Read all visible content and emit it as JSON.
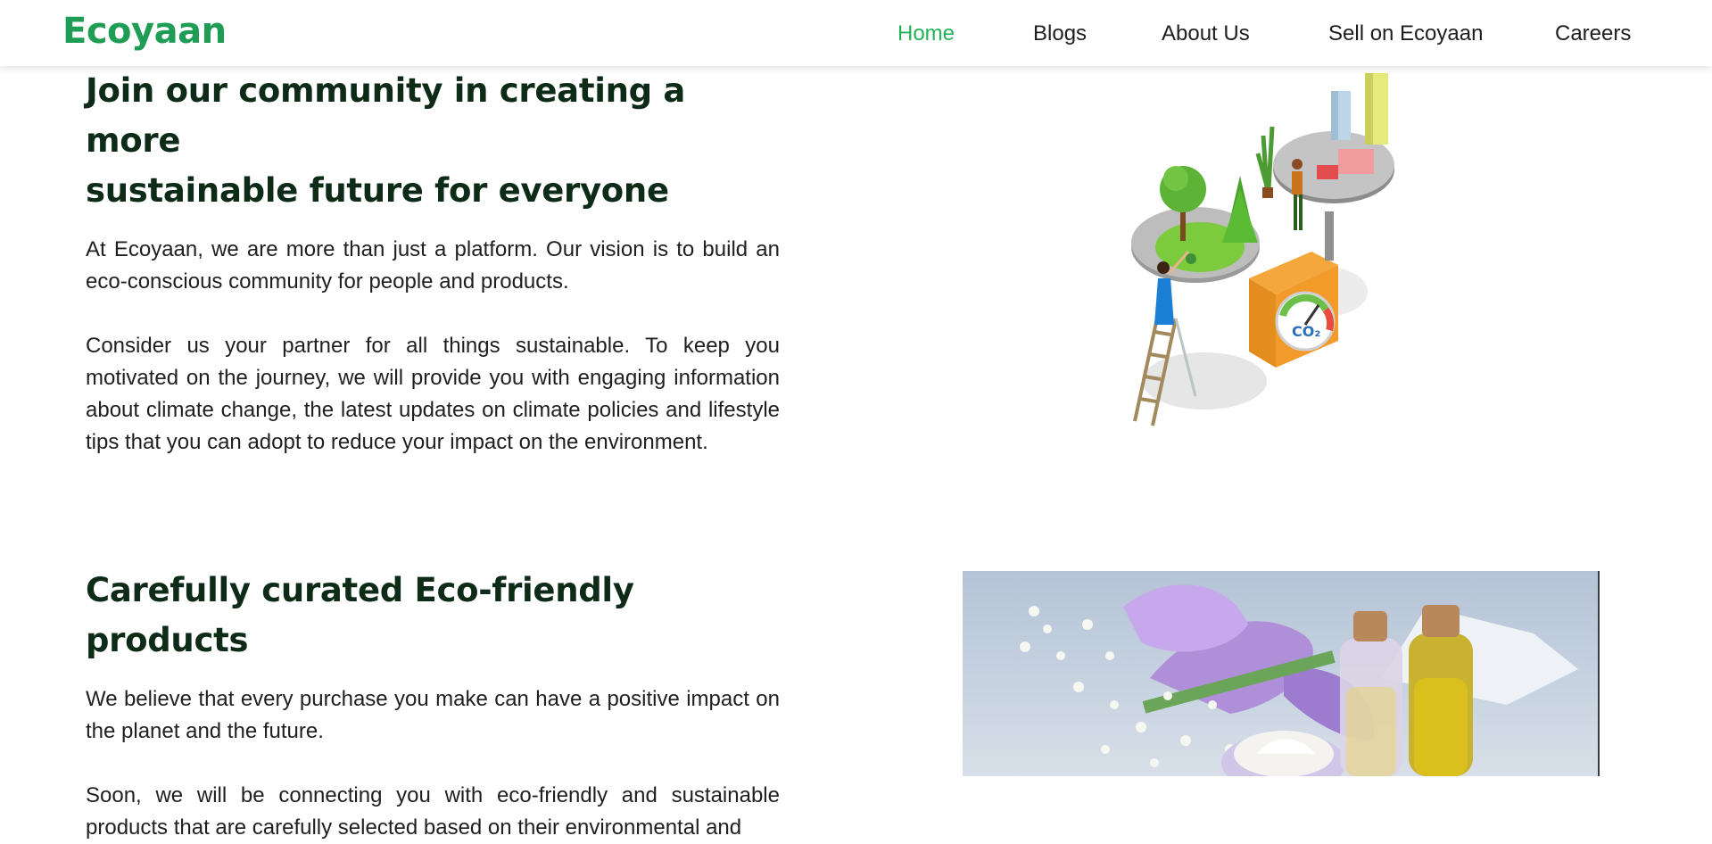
{
  "brand": {
    "name": "Ecoyaan",
    "color": "#1f9d55"
  },
  "nav": {
    "items": [
      {
        "label": "Home",
        "active": true
      },
      {
        "label": "Blogs",
        "active": false
      },
      {
        "label": "About Us",
        "active": false
      },
      {
        "label": "Sell on Ecoyaan",
        "active": false
      },
      {
        "label": "Careers",
        "active": false
      }
    ],
    "active_color": "#22b358"
  },
  "community": {
    "title_line1": "Join our community in creating a more",
    "title_line2": "sustainable future for everyone",
    "para1": "At Ecoyaan, we are more than just a platform. Our vision is to build an eco-conscious community for people and products.",
    "para2": "Consider us your partner for all things sustainable. To keep you motivated on the journey, we will provide you with engaging information about climate change, the latest updates on climate policies and lifestyle tips that you can adopt to reduce your impact on the environment.",
    "illustration_label": "CO₂"
  },
  "products": {
    "title": "Carefully curated Eco-friendly products",
    "para1": "We believe that every purchase you make can have a positive impact on the planet and the future.",
    "para2": "Soon, we will be connecting you with eco-friendly and sustainable products that are carefully selected based on their environmental and"
  }
}
